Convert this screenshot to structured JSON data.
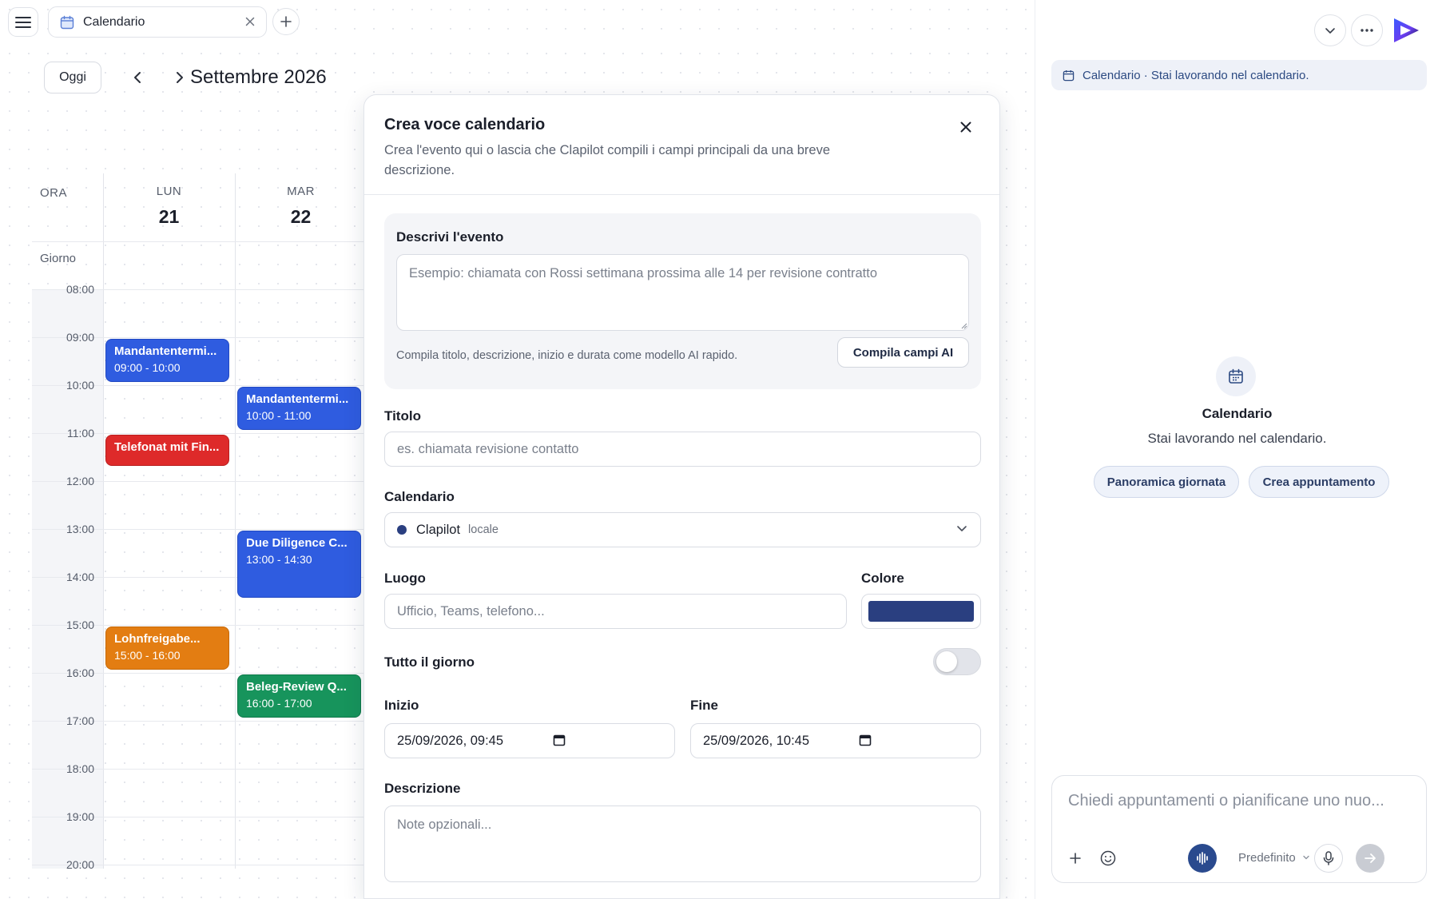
{
  "tabbar": {
    "tab_label": "Calendario"
  },
  "calendar": {
    "today_label": "Oggi",
    "month_title": "Settembre 2026",
    "time_header": "ORA",
    "allday_label": "Giorno",
    "days": [
      {
        "dow": "LUN",
        "num": "21"
      },
      {
        "dow": "MAR",
        "num": "22"
      }
    ],
    "hours": [
      "08:00",
      "09:00",
      "10:00",
      "11:00",
      "12:00",
      "13:00",
      "14:00",
      "15:00",
      "16:00",
      "17:00",
      "18:00",
      "19:00",
      "20:00"
    ],
    "events": [
      {
        "title": "Mandantentermi...",
        "time": "09:00 - 10:00",
        "color": "#2f5ce0"
      },
      {
        "title": "Telefonat mit Fin...",
        "time": "",
        "color": "#de2a2a"
      },
      {
        "title": "Lohnfreigabe...",
        "time": "15:00 - 16:00",
        "color": "#e37d12"
      },
      {
        "title": "Mandantentermi...",
        "time": "10:00 - 11:00",
        "color": "#2f5ce0"
      },
      {
        "title": "Due Diligence C...",
        "time": "13:00 - 14:30",
        "color": "#2f5ce0"
      },
      {
        "title": "Beleg-Review Q...",
        "time": "16:00 - 17:00",
        "color": "#17945c"
      }
    ]
  },
  "modal": {
    "title": "Crea voce calendario",
    "subtitle": "Crea l'evento qui o lascia che Clapilot compili i campi principali da una breve descrizione.",
    "ai": {
      "label": "Descrivi l'evento",
      "placeholder": "Esempio: chiamata con Rossi settimana prossima alle 14 per revisione contratto",
      "hint": "Compila titolo, descrizione, inizio e durata come modello AI rapido.",
      "button": "Compila campi AI"
    },
    "title_field": {
      "label": "Titolo",
      "placeholder": "es. chiamata revisione contatto"
    },
    "calendar_field": {
      "label": "Calendario",
      "value": "Clapilot",
      "tag": "locale"
    },
    "location_field": {
      "label": "Luogo",
      "placeholder": "Ufficio, Teams, telefono..."
    },
    "color_field": {
      "label": "Colore",
      "value": "#2a3f80"
    },
    "allday": {
      "label": "Tutto il giorno",
      "on": false
    },
    "start": {
      "label": "Inizio",
      "value": "25/09/2026, 09:45"
    },
    "end": {
      "label": "Fine",
      "value": "25/09/2026, 10:45"
    },
    "description": {
      "label": "Descrizione",
      "placeholder": "Note opzionali..."
    }
  },
  "assistant": {
    "banner": "Calendario · Stai lavorando nel calendario.",
    "context_title": "Calendario",
    "context_sub": "Stai lavorando nel calendario.",
    "chips": [
      "Panoramica giornata",
      "Crea appuntamento"
    ],
    "composer_placeholder": "Chiedi appuntamenti o pianificane uno nuo...",
    "model": "Predefinito"
  }
}
